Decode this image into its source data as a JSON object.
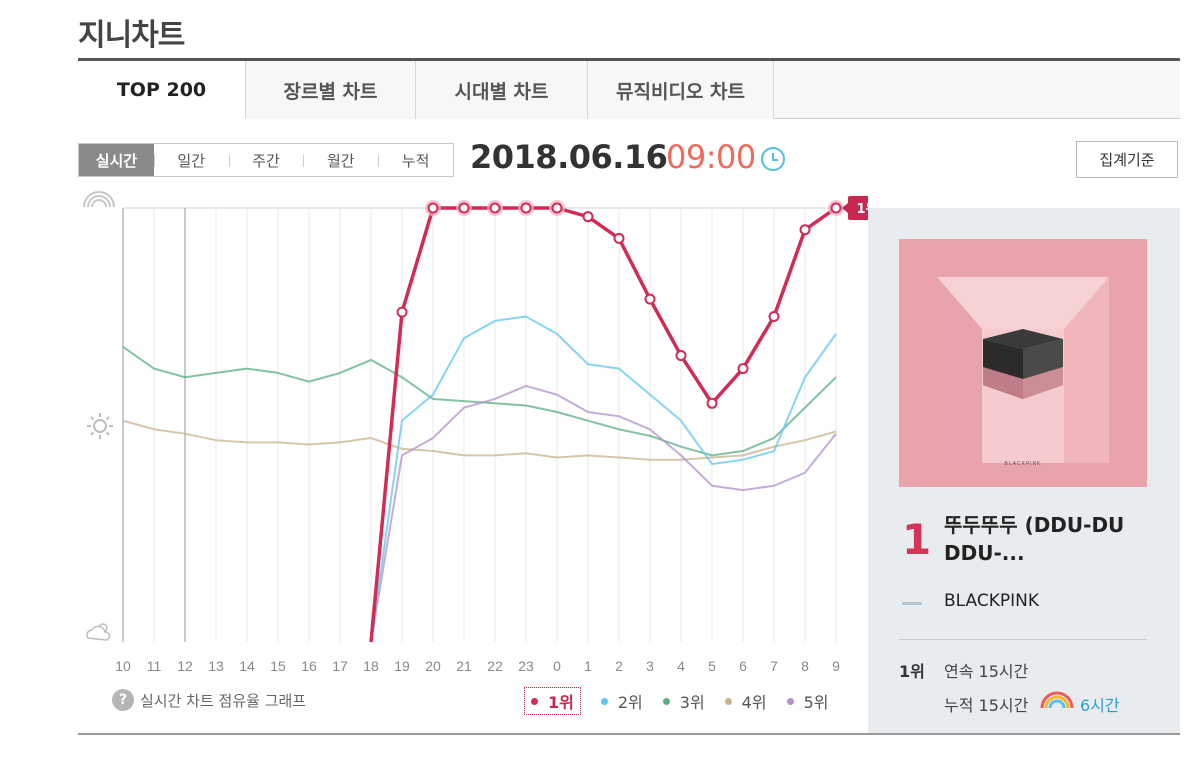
{
  "site_title": "지니차트",
  "tabs": [
    {
      "label": "TOP 200",
      "active": true
    },
    {
      "label": "장르별 차트",
      "active": false
    },
    {
      "label": "시대별 차트",
      "active": false
    },
    {
      "label": "뮤직비디오 차트",
      "active": false
    }
  ],
  "period_tabs": [
    {
      "label": "실시간",
      "active": true
    },
    {
      "label": "일간",
      "active": false
    },
    {
      "label": "주간",
      "active": false
    },
    {
      "label": "월간",
      "active": false
    },
    {
      "label": "누적",
      "active": false
    }
  ],
  "chart_date": "2018.06.16",
  "chart_time": "09:00",
  "criteria_button": "집계기준",
  "chart_data": {
    "type": "line",
    "x": [
      "10",
      "11",
      "12",
      "13",
      "14",
      "15",
      "16",
      "17",
      "18",
      "19",
      "20",
      "21",
      "22",
      "23",
      "0",
      "1",
      "2",
      "3",
      "4",
      "5",
      "6",
      "7",
      "8",
      "9"
    ],
    "y_label_top": "",
    "series": [
      {
        "name": "1위",
        "color": "#d22b55",
        "values": [
          null,
          null,
          null,
          null,
          null,
          null,
          null,
          null,
          0.0,
          0.76,
          1.0,
          1.0,
          1.0,
          1.0,
          1.0,
          0.98,
          0.93,
          0.79,
          0.66,
          0.55,
          0.63,
          0.75,
          0.95,
          1.0
        ]
      },
      {
        "name": "2위",
        "color": "#5fc6ee",
        "values": [
          null,
          null,
          null,
          null,
          null,
          null,
          null,
          null,
          0.0,
          0.51,
          0.57,
          0.7,
          0.74,
          0.75,
          0.71,
          0.64,
          0.63,
          0.57,
          0.51,
          0.41,
          0.42,
          0.44,
          0.61,
          0.71
        ]
      },
      {
        "name": "3위",
        "color": "#5aae83",
        "values": [
          0.68,
          0.63,
          0.61,
          0.62,
          0.63,
          0.62,
          0.6,
          0.62,
          0.65,
          0.61,
          0.56,
          0.555,
          0.55,
          0.545,
          0.53,
          0.51,
          0.49,
          0.475,
          0.45,
          0.43,
          0.44,
          0.47,
          0.54,
          0.61
        ]
      },
      {
        "name": "4위",
        "color": "#c9b38f",
        "values": [
          0.51,
          0.49,
          0.48,
          0.465,
          0.46,
          0.46,
          0.455,
          0.46,
          0.47,
          0.445,
          0.44,
          0.43,
          0.43,
          0.435,
          0.425,
          0.43,
          0.425,
          0.42,
          0.42,
          0.425,
          0.43,
          0.45,
          0.465,
          0.485
        ]
      },
      {
        "name": "5위",
        "color": "#b391c9",
        "values": [
          null,
          null,
          null,
          null,
          null,
          null,
          null,
          null,
          0.0,
          0.43,
          0.47,
          0.54,
          0.56,
          0.59,
          0.57,
          0.53,
          0.52,
          0.49,
          0.43,
          0.36,
          0.35,
          0.36,
          0.39,
          0.48
        ]
      }
    ],
    "highlight_label": "1위",
    "grid": true,
    "legend_position": "bottom-right",
    "help_text": "실시간 차트 점유율 그래프"
  },
  "selected_song": {
    "rank": "1",
    "title": "뚜두뚜두 (DDU-DU DDU-...",
    "artist": "BLACKPINK",
    "album_text": "BLACKPINK",
    "rank_label": "1위",
    "streak": "연속 15시간",
    "total": "누적 15시간",
    "top_hours": "6시간"
  }
}
